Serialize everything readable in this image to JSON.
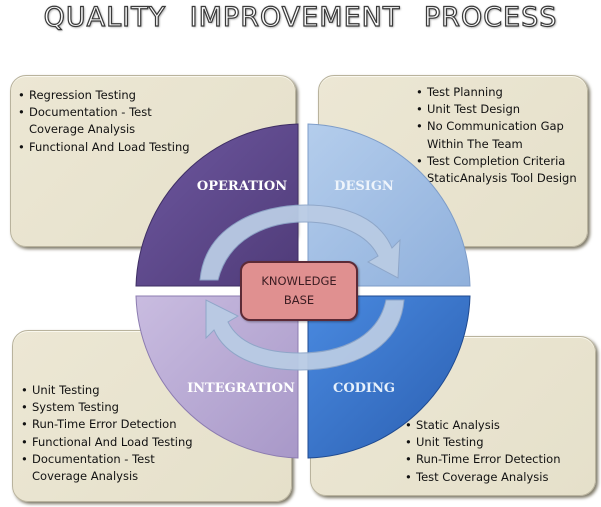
{
  "title": "QUALITY IMPROVEMENT PROCESS",
  "center": {
    "line1": "KNOWLEDGE",
    "line2": "BASE"
  },
  "segments": {
    "operation": {
      "label": "OPERATION",
      "color": "#5f4a8b"
    },
    "design": {
      "label": "DESIGN",
      "color": "#a4c0e4"
    },
    "integration": {
      "label": "INTEGRATION",
      "color": "#b8a8d4"
    },
    "coding": {
      "label": "CODING",
      "color": "#3a78cc"
    }
  },
  "boxes": {
    "operation": [
      [
        "Regression Testing"
      ],
      [
        "Documentation - Test",
        "Coverage Analysis"
      ],
      [
        "Functional And Load Testing"
      ]
    ],
    "design": [
      [
        "Test Planning"
      ],
      [
        "Unit Test Design"
      ],
      [
        "No Communication Gap",
        "Within The Team"
      ],
      [
        "Test Completion Criteria"
      ],
      [
        "StaticAnalysis Tool Design"
      ]
    ],
    "integration": [
      [
        "Unit Testing"
      ],
      [
        "System Testing"
      ],
      [
        "Run-Time Error Detection"
      ],
      [
        "Functional And Load Testing"
      ],
      [
        "Documentation - Test",
        "Coverage Analysis"
      ]
    ],
    "coding": [
      [
        "Static Analysis"
      ],
      [
        "Unit Testing"
      ],
      [
        "Run-Time Error Detection"
      ],
      [
        "Test Coverage Analysis"
      ]
    ]
  },
  "colors": {
    "box_fill": "#e8e3ce",
    "arrow": "#b7c9e2",
    "center_fill": "#e09090"
  }
}
